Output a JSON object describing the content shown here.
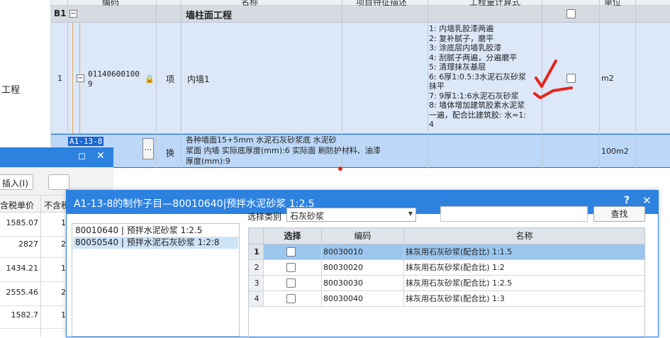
{
  "left_panel": {
    "label": "工程"
  },
  "grid": {
    "header_cut": [
      "编码",
      "名称",
      "项目特征描述",
      "工程量计算式",
      "单位"
    ],
    "b1": {
      "code": "B1",
      "title": "墙柱面工程"
    },
    "row1": {
      "num": "1",
      "code_line1": "01140600100",
      "code_line2": "9",
      "type": "项",
      "name": "内墙1",
      "unit": "m2",
      "desc": [
        "1: 内墙乳胶漆两遍",
        "2: 复补腻子，磨平",
        "3: 涂底层内墙乳胶漆",
        "4: 刮腻子两遍，分遍磨平",
        "5: 清理抹灰基层",
        "6: 6厚1:0.5:3水泥石灰砂浆",
        "抹平",
        "7: 9厚1:1:6水泥石灰砂浆",
        "8: 墙体增加建筑胶素水泥浆",
        "一遍，配合比建筑胶: 水=1:",
        "4"
      ]
    },
    "row2": {
      "code": "A1-13-8",
      "more": "...",
      "type": "换",
      "name_lines": [
        "各种墙面15+5mm 水泥石灰砂浆底 水泥砂",
        "浆面 内墙  实际底厚度(mm):6  实际面  刷防护材料、油漆",
        "厚度(mm):9"
      ],
      "unit": "100m2"
    }
  },
  "bg_panel": {
    "insert_button": "插入(I)",
    "header": [
      "含税单价",
      "不含税"
    ],
    "values": [
      "1585.07",
      "2827",
      "1434.21",
      "2555.46",
      "1582.7"
    ],
    "values2": [
      "1",
      "2",
      "1",
      "2",
      "1"
    ]
  },
  "dialog": {
    "title": "A1-13-8的制作子目—80010640|预拌水泥砂浆 1:2.5",
    "help": "?",
    "close": "✕",
    "list": [
      "80010640 | 预拌水泥砂浆 1:2.5",
      "80050540 | 预拌水泥石灰砂浆 1:2:8"
    ],
    "category_label": "选择类别",
    "category_value": "石灰砂浆",
    "find_button": "查找",
    "table": {
      "headers": [
        "选择",
        "编码",
        "名称"
      ],
      "rows": [
        {
          "n": "1",
          "code": "80030010",
          "name": "抹灰用石灰砂浆(配合比) 1:1.5"
        },
        {
          "n": "2",
          "code": "80030020",
          "name": "抹灰用石灰砂浆(配合比) 1:2"
        },
        {
          "n": "3",
          "code": "80030030",
          "name": "抹灰用石灰砂浆(配合比) 1:2.5"
        },
        {
          "n": "4",
          "code": "80030040",
          "name": "抹灰用石灰砂浆(配合比) 1:3"
        }
      ]
    }
  },
  "colors": {
    "accent": "#2d82e0",
    "selected_row": "#9cc6ee",
    "annotation": "#e8231b"
  }
}
